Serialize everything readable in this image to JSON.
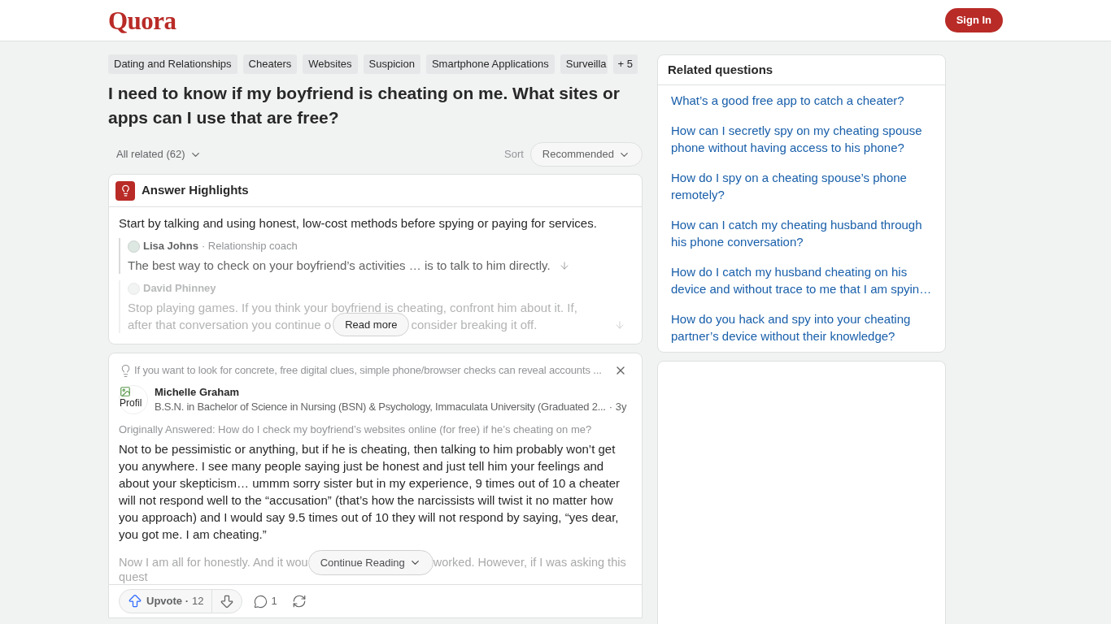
{
  "header": {
    "logo": "Quora",
    "sign_in_button": "Sign In"
  },
  "topics": {
    "items": [
      "Dating and Relationships",
      "Cheaters",
      "Websites",
      "Suspicion",
      "Smartphone Applications",
      "Surveilla"
    ],
    "more": "+ 5"
  },
  "question": {
    "title": "I need to know if my boyfriend is cheating on me. What sites or apps can I use that are free?"
  },
  "filter_bar": {
    "filter": "All related (62)",
    "sort_label": "Sort",
    "sort_value": "Recommended"
  },
  "answer_highlights": {
    "title": "Answer Highlights",
    "summary": "Start by talking and using honest, low-cost methods before spying or paying for services.",
    "quotes": [
      {
        "author": "Lisa Johns",
        "credential": "· Relationship coach",
        "text": "The best way to check on your boyfriend’s activities … is to talk to him directly.",
        "faded": false
      },
      {
        "author": "David Phinney",
        "text": "Stop playing games. If you think your boyfriend is cheating, confront him about it. If,",
        "text_before_button": "after that conversation you continue o",
        "text_after_button": "consider breaking it off.",
        "faded": true
      }
    ],
    "read_more": "Read more"
  },
  "answer": {
    "prompt": "If you want to look for concrete, free digital clues, simple phone/browser checks can reveal accounts ...",
    "avatar_alt": "Profil",
    "author": "Michelle Graham",
    "credential": "B.S.N. in Bachelor of Science in Nursing (BSN) & Psychology, Immaculata University (Graduated 2...",
    "age": "· 3y",
    "originally_answered": "Originally Answered: How do I check my boyfriend’s websites online (for free) if he’s cheating on me?",
    "body": "Not to be pessimistic or anything, but if he is cheating, then talking to him probably won’t get you anywhere. I see many people saying just be honest and just tell him your feelings and about your skepticism… ummm sorry sister but in my experience, 9 times out of 10 a cheater will not respond well to the “accusation” (that’s how the narcissists will twist it no matter how you approach) and I would say 9.5 times out of 10 they will not respond by saying, “yes dear, you got me. I am cheating.”",
    "preview_before_button": "Now I am all for honestly. And it wou",
    "preview_after_button": "worked. However, if I was asking this",
    "preview_next_line": "quest",
    "continue_reading": "Continue Reading",
    "upvote": {
      "label": "Upvote ·",
      "count": "12"
    },
    "comments": "1"
  },
  "related": {
    "title": "Related questions",
    "items": [
      "What’s a good free app to catch a cheater?",
      "How can I secretly spy on my cheating spouse phone without having access to his phone?",
      "How do I spy on a cheating spouse’s phone remotely?",
      "How can I catch my cheating husband through his phone conversation?",
      "How do I catch my husband cheating on his device and without trace to me that I am spyin…",
      "How do you hack and spy into your cheating partner’s device without their knowledge?"
    ]
  }
}
